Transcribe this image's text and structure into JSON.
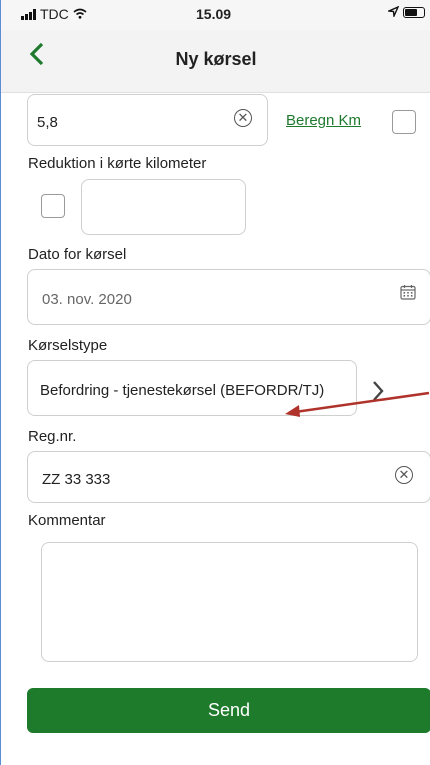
{
  "status_bar": {
    "carrier": "TDC",
    "time": "15.09"
  },
  "nav": {
    "back_icon": "chevron-left",
    "title": "Ny kørsel"
  },
  "km": {
    "value": "5,8",
    "calc_link": "Beregn Km"
  },
  "reduction": {
    "label": "Reduktion i kørte kilometer",
    "value": ""
  },
  "date": {
    "label": "Dato for kørsel",
    "value": "03. nov. 2020"
  },
  "trip_type": {
    "label": "Kørselstype",
    "value": "Befordring - tjenestekørsel (BEFORDR/TJ)"
  },
  "reg": {
    "label": "Reg.nr.",
    "value": "ZZ 33 333"
  },
  "comment": {
    "label": "Kommentar",
    "value": ""
  },
  "send_label": "Send",
  "colors": {
    "accent": "#1e7b2c",
    "annotation_arrow": "#b0332b"
  }
}
